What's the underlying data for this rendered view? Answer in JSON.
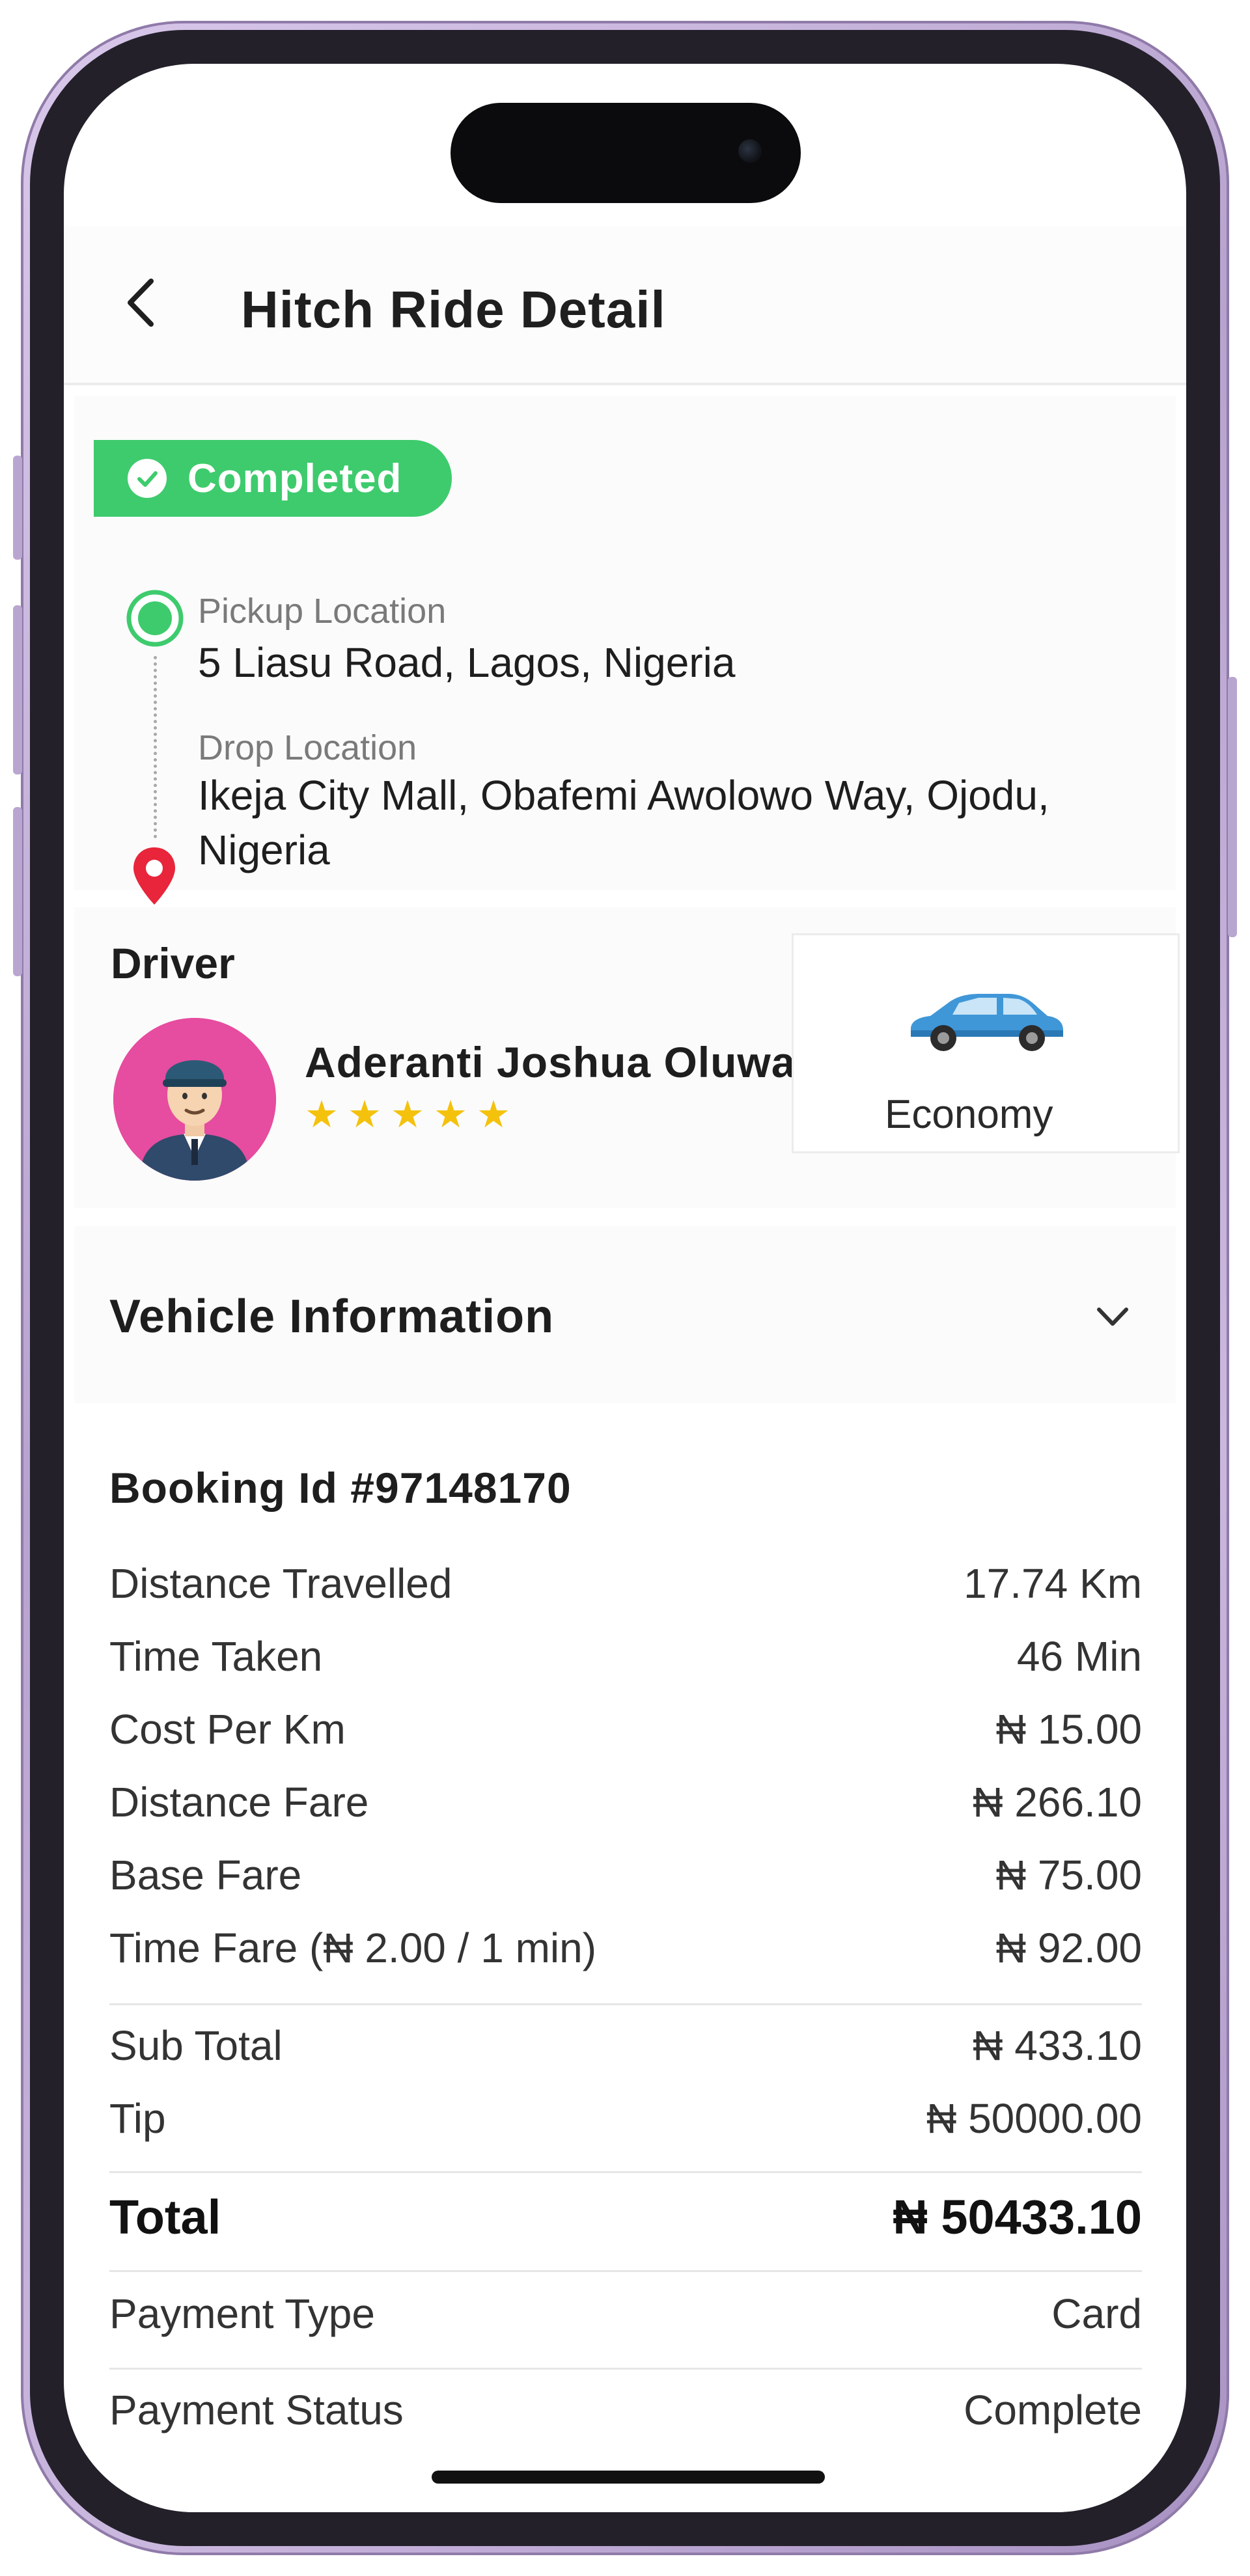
{
  "header": {
    "title": "Hitch Ride Detail"
  },
  "status": {
    "label": "Completed",
    "color": "#3ecb6d"
  },
  "locations": {
    "pickup_label": "Pickup Location",
    "pickup_value": "5 Liasu Road, Lagos, Nigeria",
    "drop_label": "Drop Location",
    "drop_value": "Ikeja City Mall, Obafemi Awolowo Way, Ojodu, Nigeria"
  },
  "driver": {
    "heading": "Driver",
    "name": "Aderanti Joshua Oluwafemi",
    "rating": 5,
    "vehicle_type": "Economy"
  },
  "vehicle_info": {
    "title": "Vehicle Information"
  },
  "booking": {
    "id_label": "Booking Id #97148170",
    "rows": [
      {
        "label": "Distance Travelled",
        "value": "17.74 Km"
      },
      {
        "label": "Time Taken",
        "value": "46 Min"
      },
      {
        "label": "Cost Per Km",
        "value": "₦ 15.00"
      },
      {
        "label": "Distance Fare",
        "value": "₦ 266.10"
      },
      {
        "label": "Base Fare",
        "value": "₦ 75.00"
      },
      {
        "label": "Time Fare (₦ 2.00 / 1 min)",
        "value": "₦ 92.00"
      }
    ],
    "subtotal_rows": [
      {
        "label": "Sub Total",
        "value": "₦ 433.10"
      },
      {
        "label": "Tip",
        "value": "₦ 50000.00"
      }
    ],
    "total": {
      "label": "Total",
      "value": "₦ 50433.10"
    },
    "payment_rows": [
      {
        "label": "Payment Type",
        "value": "Card"
      },
      {
        "label": "Payment Status",
        "value": "Complete"
      }
    ]
  },
  "icons": {
    "back": "chevron-left-icon",
    "status": "check-circle-icon",
    "pickup": "pickup-dot-icon",
    "drop": "map-pin-icon",
    "car": "car-icon",
    "expand": "chevron-down-icon",
    "star": "star-icon"
  }
}
